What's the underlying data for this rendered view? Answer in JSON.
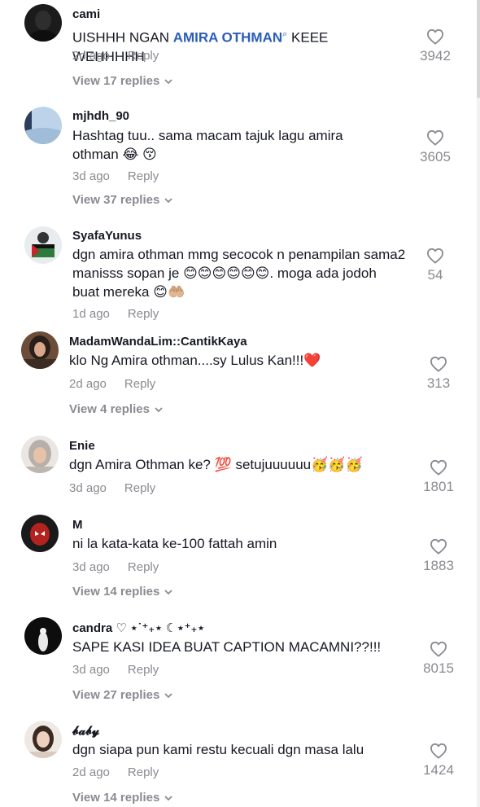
{
  "comments": [
    {
      "username": "cami",
      "text_before": "UISHHH NGAN ",
      "mention": "AMIRA OTHMAN",
      "mention_icon": "search-icon",
      "text_after": " KEEE WEHHHHH",
      "date": "2d ago",
      "reply": "Reply",
      "view_replies": "View 17 replies",
      "likes": "3942"
    },
    {
      "username": "mjhdh_90",
      "text": "Hashtag tuu.. sama macam tajuk lagu amira othman 😂 😚",
      "date": "3d ago",
      "reply": "Reply",
      "view_replies": "View 37 replies",
      "likes": "3605"
    },
    {
      "username": "SyafaYunus",
      "text": "dgn amira othman mmg secocok n penampilan sama2 manisss sopan je 😊😊😊😊😊😊. moga ada jodoh buat mereka 😊🤲🏼",
      "date": "1d ago",
      "reply": "Reply",
      "likes": "54"
    },
    {
      "username": "MadamWandaLim::CantikKaya",
      "text": "klo Ng Amira othman....sy Lulus Kan!!!❤️",
      "date": "2d ago",
      "reply": "Reply",
      "view_replies": "View 4 replies",
      "likes": "313"
    },
    {
      "username": "Enie",
      "text": "dgn Amira Othman ke? 💯 setujuuuuuu🥳🥳🥳",
      "date": "3d ago",
      "reply": "Reply",
      "likes": "1801"
    },
    {
      "username": "M",
      "text": "ni la kata-kata ke-100 fattah amin",
      "date": "3d ago",
      "reply": "Reply",
      "view_replies": "View 14 replies",
      "likes": "1883"
    },
    {
      "username": "candra ♡ ⋆˙⁺₊⋆ ☾⋆⁺₊⋆",
      "text": "SAPE KASI IDEA BUAT CAPTION MACAMNI??!!!",
      "date": "3d ago",
      "reply": "Reply",
      "view_replies": "View 27 replies",
      "likes": "8015"
    },
    {
      "username": "𝓫𝓪𝓫𝔂",
      "text": "dgn siapa pun kami restu kecuali dgn masa lalu",
      "date": "2d ago",
      "reply": "Reply",
      "view_replies": "View 14 replies",
      "likes": "1424"
    }
  ],
  "icons": {
    "like": "heart-outline-icon",
    "expand": "chevron-down-icon"
  },
  "colors": {
    "text": "#161823",
    "secondary": "#8a8b91",
    "mention": "#2b5db9"
  }
}
